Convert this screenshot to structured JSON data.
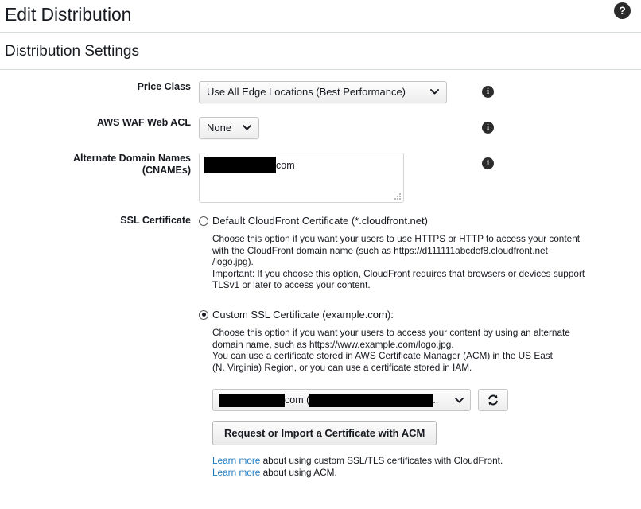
{
  "header": {
    "title": "Edit Distribution",
    "help_icon": "question-mark-circle-icon",
    "help_label": "?"
  },
  "section": {
    "title": "Distribution Settings"
  },
  "info_icon_label": "i",
  "fields": {
    "price_class": {
      "label": "Price Class",
      "value": "Use All Edge Locations (Best Performance)",
      "caret": "❯",
      "info_icon": "info-icon"
    },
    "waf_acl": {
      "label": "AWS WAF Web ACL",
      "value": "None",
      "caret": "❯",
      "info_icon": "info-icon"
    },
    "cnames": {
      "label_line1": "Alternate Domain Names",
      "label_line2": "(CNAMEs)",
      "value_redacted": true,
      "value_visible_tail": "com",
      "info_icon": "info-icon"
    },
    "ssl_certificate": {
      "label": "SSL Certificate",
      "options": [
        {
          "id": "default-cloudfront-certificate",
          "label": "Default CloudFront Certificate (*.cloudfront.net)",
          "selected": false,
          "description": [
            "Choose this option if you want your users to use HTTPS or HTTP to access your content",
            "with the CloudFront domain name (such as https://d111111abcdef8.cloudfront.net",
            "/logo.jpg).",
            "Important: If you choose this option, CloudFront requires that browsers or devices support",
            "TLSv1 or later to access your content."
          ]
        },
        {
          "id": "custom-ssl-certificate",
          "label": "Custom SSL Certificate (example.com):",
          "selected": true,
          "description": [
            "Choose this option if you want your users to access your content by using an alternate",
            "domain name, such as https://www.example.com/logo.jpg.",
            "You can use a certificate stored in AWS Certificate Manager (ACM) in the US East",
            "(N. Virginia) Region, or you can use a certificate stored in IAM."
          ]
        }
      ]
    },
    "certificate_picker": {
      "selected_middle_text": "com (",
      "selected_tail_text": "..",
      "caret": "❯",
      "refresh_icon": "refresh-icon",
      "acm_button_label": "Request or Import a Certificate with ACM"
    },
    "help_links": [
      {
        "link_text": "Learn more",
        "rest_text": " about using custom SSL/TLS certificates with CloudFront."
      },
      {
        "link_text": "Learn more",
        "rest_text": " about using ACM."
      }
    ]
  },
  "colors": {
    "link": "#1f7bbf",
    "text": "#16191f",
    "divider": "#d5dbdb",
    "redaction": "#000000"
  }
}
